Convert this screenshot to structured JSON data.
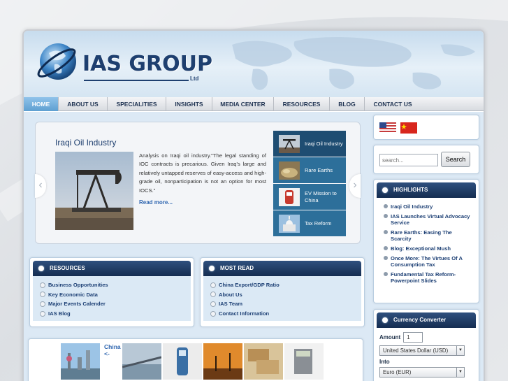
{
  "brand": {
    "name": "IAS GROUP",
    "suffix": "Ltd"
  },
  "nav": [
    {
      "label": "HOME",
      "active": true
    },
    {
      "label": "ABOUT US"
    },
    {
      "label": "SPECIALITIES"
    },
    {
      "label": "INSIGHTS"
    },
    {
      "label": "MEDIA CENTER"
    },
    {
      "label": "RESOURCES"
    },
    {
      "label": "BLOG"
    },
    {
      "label": "CONTACT US"
    }
  ],
  "slider": {
    "title": "Iraqi Oil Industry",
    "text": "Analysis on Iraqi oil industry.\"The legal standing of IOC contracts is precarious. Given Iraq's large and relatively untapped reserves of easy-access and high-grade oil, nonparticipation is not an option for most IOCS.\"",
    "more": "Read more...",
    "tabs": [
      {
        "label": "Iraqi Oil Industry",
        "icon": "oil-pump-thumb",
        "active": true
      },
      {
        "label": "Rare Earths",
        "icon": "rare-earth-thumb"
      },
      {
        "label": "EV Mission to China",
        "icon": "ev-charger-thumb"
      },
      {
        "label": "Tax Reform",
        "icon": "capitol-thumb"
      }
    ]
  },
  "resources": {
    "title": "RESOURCES",
    "links": [
      "Business Opportunities",
      "Key Economic Data",
      "Major Events Calender",
      "IAS Blog"
    ]
  },
  "most_read": {
    "title": "MOST READ",
    "links": [
      "China Export/GDP Ratio",
      "About Us",
      "IAS Team",
      "Contact Information"
    ]
  },
  "search": {
    "placeholder": "search...",
    "button": "Search"
  },
  "highlights": {
    "title": "HIGHLIGHTS",
    "links": [
      "Iraqi Oil Industry",
      "IAS Launches Virtual Advocacy Service",
      "Rare Earths: Easing The Scarcity",
      "Blog: Exceptional Mush",
      "Once More: The Virtues Of A Consumption Tax",
      "Fundamental Tax Reform- Powerpoint Slides"
    ]
  },
  "currency": {
    "title": "Currency Converter",
    "amount_label": "Amount",
    "amount_value": "1",
    "from_value": "United States Dollar (USD)",
    "into_label": "Into",
    "into_value": "Euro (EUR)"
  },
  "gallery": {
    "label": "China",
    "sub": "<-"
  },
  "colors": {
    "navy": "#1e3f6f",
    "link": "#1c3f74",
    "nav_active": "#5e9fd1",
    "header_bar": "#152d51"
  }
}
